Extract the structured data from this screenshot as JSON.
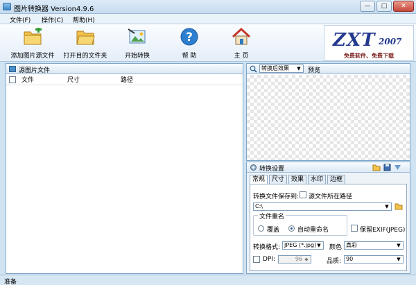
{
  "window": {
    "title": "图片转换器 Version4.9.6",
    "minimize": "—",
    "maximize": "□",
    "close": "✕"
  },
  "menu": [
    {
      "label": "文件(F)"
    },
    {
      "label": "操作(C)"
    },
    {
      "label": "帮助(H)"
    }
  ],
  "toolbar": {
    "add_source": "添加图片源文件",
    "open_target": "打开目的文件夹",
    "start_convert": "开始转换",
    "help": "帮 助",
    "home": "主 页"
  },
  "logo": {
    "brand": "ZXT",
    "year": "2007",
    "slogan": "免费软件、免费下载"
  },
  "source_panel": {
    "title": "源图片文件",
    "columns": [
      "文件",
      "尺寸",
      "路径"
    ],
    "rows": []
  },
  "preview_panel": {
    "effect_select": "转换后效果",
    "preview_label": "预览"
  },
  "settings_panel": {
    "title": "转换设置",
    "tabs": [
      "常规",
      "尺寸",
      "效果",
      "水印",
      "边框"
    ],
    "active_tab": "常规",
    "save_to_label": "转换文件保存到:",
    "source_path_label": "源文件所在路径",
    "path_value": "C:\\",
    "rename_group": "文件重名",
    "overwrite": "覆盖",
    "auto_rename": "自动重命名",
    "rename_choice": "auto_rename",
    "keep_exif": "保留EXIF(JPEG)",
    "format_label": "转换格式:",
    "format_value": "JPEG (*.jpg)",
    "color_label": "颜色",
    "color_value": "真彩",
    "dpi_label": "DPI:",
    "dpi_value": "96",
    "quality_label": "品质:",
    "quality_value": "90"
  },
  "status": {
    "text": "准备"
  },
  "icons": {
    "app": "app-icon",
    "add": "folder-add-icon",
    "open": "folder-open-icon",
    "convert": "image-convert-icon",
    "help": "help-icon",
    "home": "home-icon"
  },
  "colors": {
    "accent": "#3c86c7",
    "panel_border": "#7fa6c8",
    "logo_text": "#23398f"
  }
}
